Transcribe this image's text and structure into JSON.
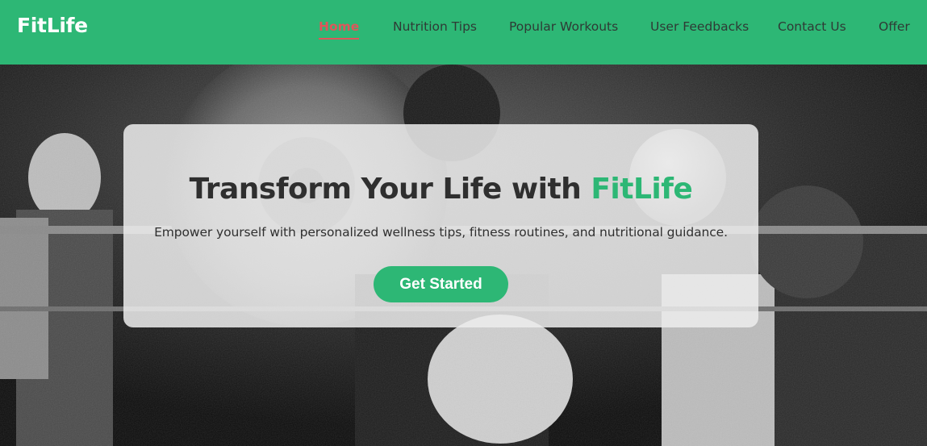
{
  "brand": {
    "name": "FitLife"
  },
  "nav": {
    "items": [
      {
        "label": "Home",
        "active": true
      },
      {
        "label": "Nutrition Tips",
        "active": false
      },
      {
        "label": "Popular Workouts",
        "active": false
      },
      {
        "label": "User Feedbacks",
        "active": false
      },
      {
        "label": "Contact Us",
        "active": false
      },
      {
        "label": "Offer",
        "active": false
      }
    ]
  },
  "hero": {
    "headline_prefix": "Transform Your Life with ",
    "headline_accent": "FitLife",
    "subtext": "Empower yourself with personalized wellness tips, fitness routines, and nutritional guidance.",
    "cta_label": "Get Started"
  },
  "colors": {
    "primary": "#2db775",
    "active_link": "#e0555a",
    "text_dark": "#2f2f2f",
    "white": "#ffffff"
  }
}
